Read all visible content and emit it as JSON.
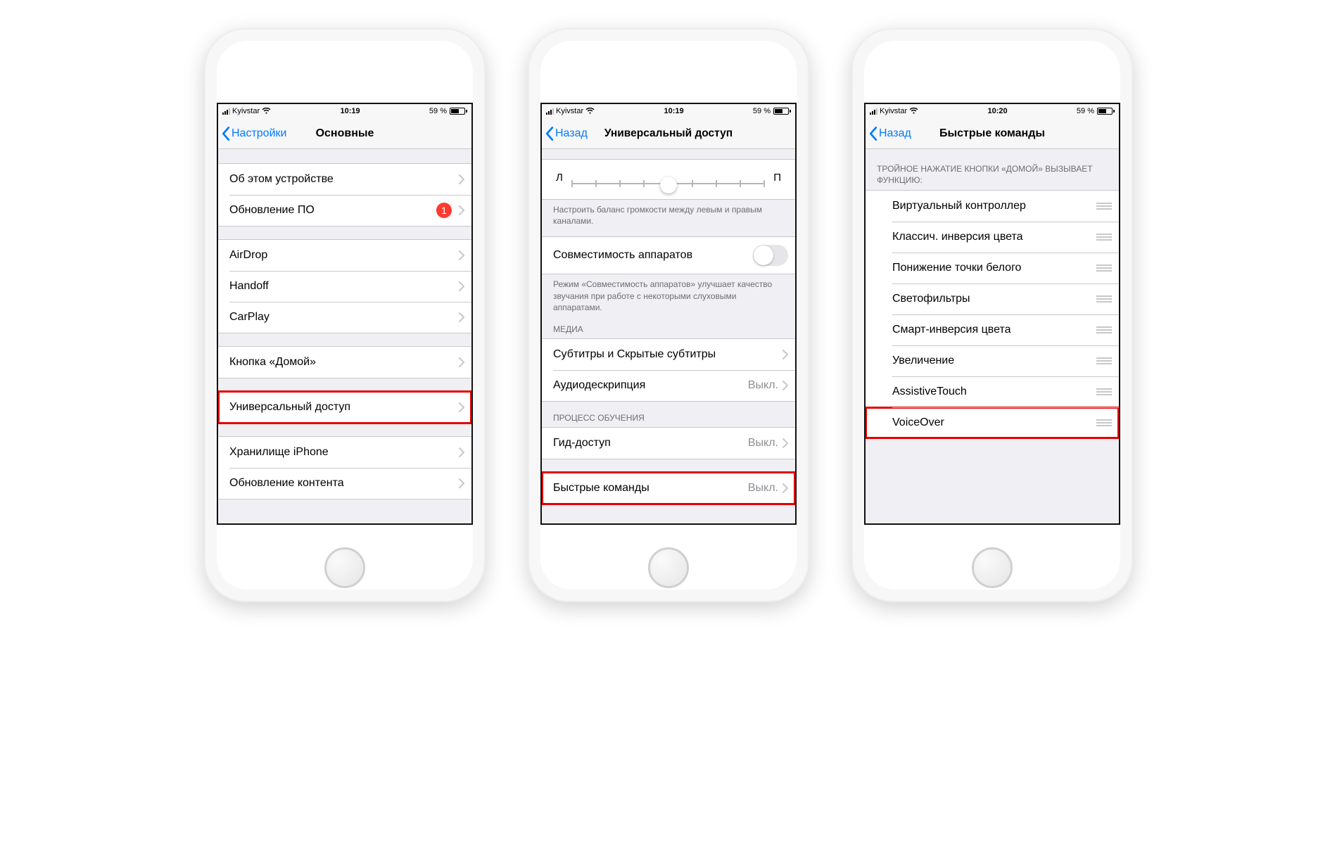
{
  "statusbar": {
    "carrier": "Kyivstar",
    "battery_pct": "59 %"
  },
  "phone1": {
    "time": "10:19",
    "back": "Настройки",
    "title": "Основные",
    "groups": [
      {
        "items": [
          {
            "label": "Об этом устройстве"
          },
          {
            "label": "Обновление ПО",
            "badge": "1"
          }
        ]
      },
      {
        "items": [
          {
            "label": "AirDrop"
          },
          {
            "label": "Handoff"
          },
          {
            "label": "CarPlay"
          }
        ]
      },
      {
        "items": [
          {
            "label": "Кнопка «Домой»"
          }
        ]
      },
      {
        "items": [
          {
            "label": "Универсальный доступ",
            "highlight": true
          }
        ]
      },
      {
        "items": [
          {
            "label": "Хранилище iPhone"
          },
          {
            "label": "Обновление контента"
          }
        ]
      }
    ]
  },
  "phone2": {
    "time": "10:19",
    "back": "Назад",
    "title": "Универсальный доступ",
    "slider": {
      "left": "Л",
      "right": "П"
    },
    "balance_footer": "Настроить баланс громкости между левым и правым каналами.",
    "compat": {
      "label": "Совместимость аппаратов"
    },
    "compat_footer": "Режим «Совместимость аппаратов» улучшает качество звучания при работе с некоторыми слуховыми аппаратами.",
    "media_header": "МЕДИА",
    "media_items": [
      {
        "label": "Субтитры и Скрытые субтитры"
      },
      {
        "label": "Аудиодескрипция",
        "value": "Выкл."
      }
    ],
    "learn_header": "ПРОЦЕСС ОБУЧЕНИЯ",
    "learn_items": [
      {
        "label": "Гид-доступ",
        "value": "Выкл."
      }
    ],
    "shortcut": {
      "label": "Быстрые команды",
      "value": "Выкл."
    }
  },
  "phone3": {
    "time": "10:20",
    "back": "Назад",
    "title": "Быстрые команды",
    "header": "ТРОЙНОЕ НАЖАТИЕ КНОПКИ «ДОМОЙ» ВЫЗЫВАЕТ ФУНКЦИЮ:",
    "items": [
      {
        "label": "Виртуальный контроллер"
      },
      {
        "label": "Классич. инверсия цвета"
      },
      {
        "label": "Понижение точки белого"
      },
      {
        "label": "Светофильтры"
      },
      {
        "label": "Смарт-инверсия цвета"
      },
      {
        "label": "Увеличение"
      },
      {
        "label": "AssistiveTouch"
      },
      {
        "label": "VoiceOver",
        "highlight": true
      }
    ]
  }
}
